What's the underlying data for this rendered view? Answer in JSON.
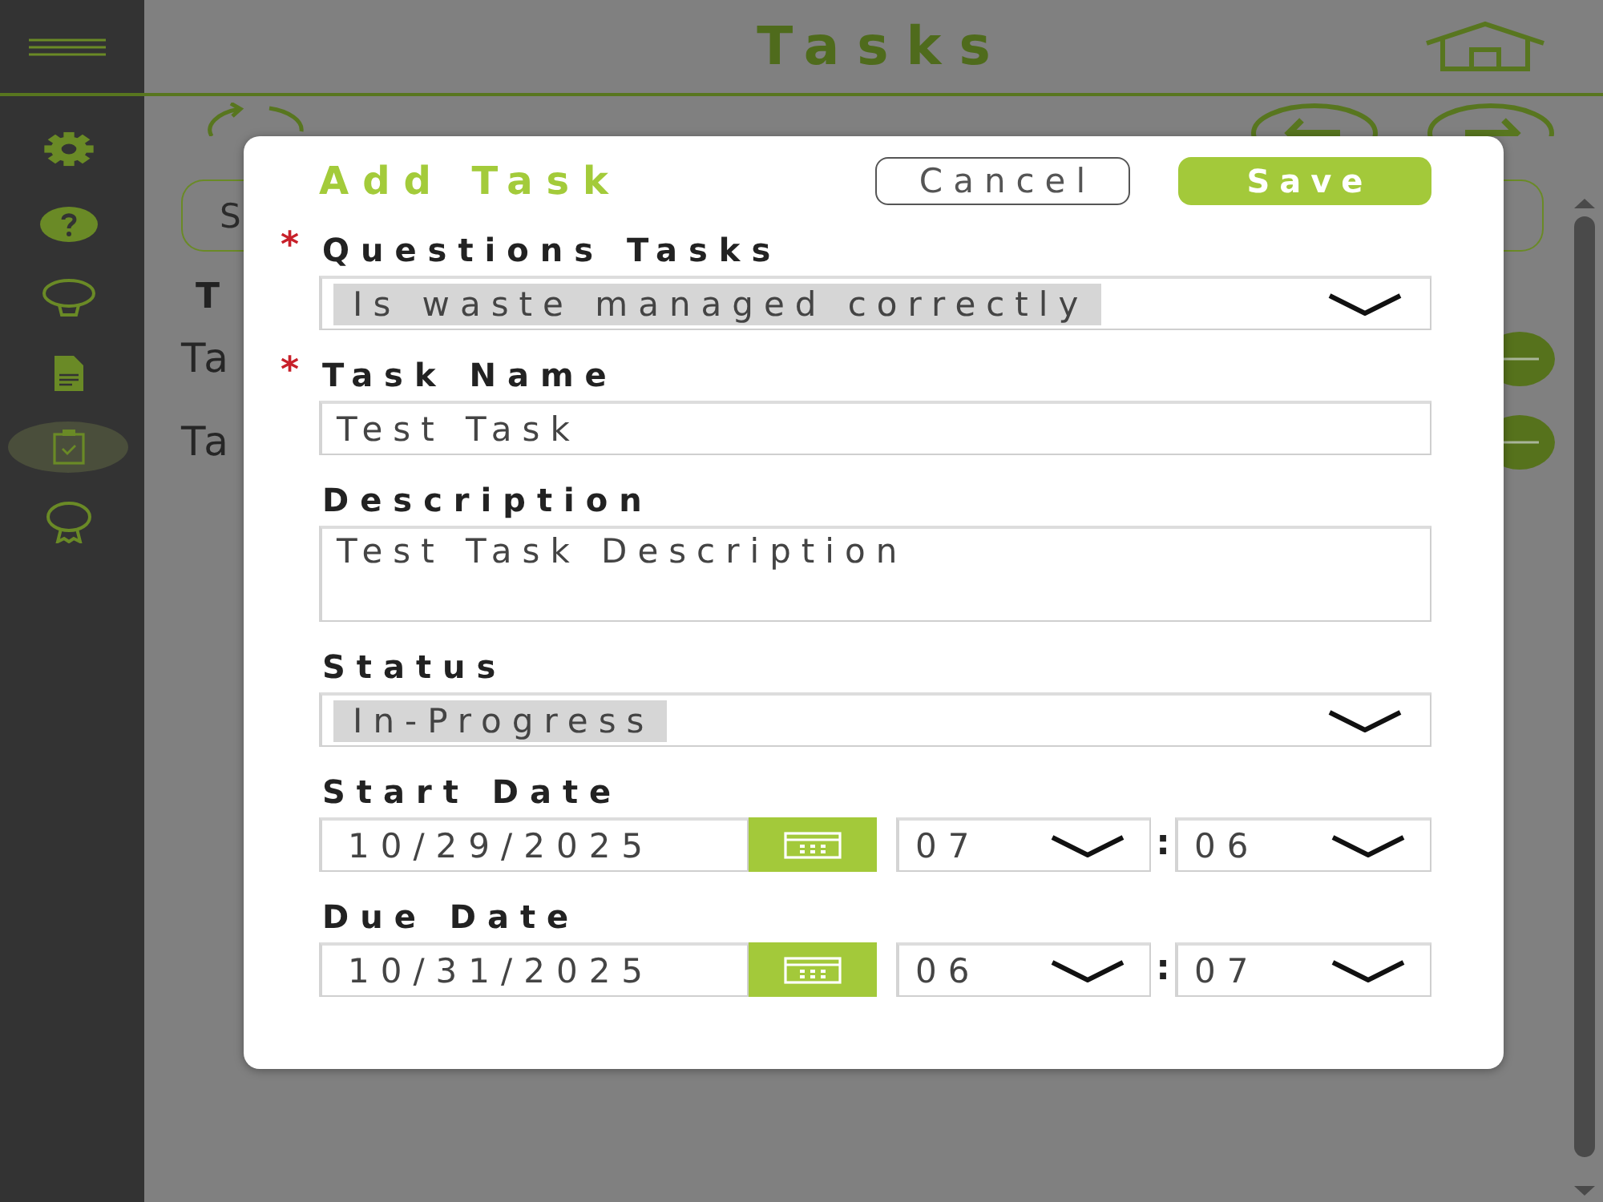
{
  "sidebar": {
    "items": [
      {
        "selected": false
      },
      {
        "selected": false
      },
      {
        "selected": false
      },
      {
        "selected": false
      },
      {
        "selected": true
      },
      {
        "selected": false
      }
    ]
  },
  "header": {
    "title": "Tasks"
  },
  "text_box": {
    "text": "S"
  },
  "list": {
    "heading": "T",
    "rows": [
      {
        "text": "Ta"
      },
      {
        "text": "Ta"
      }
    ]
  },
  "dialog": {
    "title": "Add Task",
    "buttons": [
      {
        "label": "Cancel",
        "kind": "secondary"
      },
      {
        "label": "Save",
        "kind": "primary"
      }
    ],
    "fields": [
      {
        "kind": "select",
        "required_mark": "*",
        "label": "Questions Tasks",
        "value": "Is waste managed correctly"
      },
      {
        "kind": "text",
        "required_mark": "*",
        "label": "Task Name",
        "value": "Test Task"
      },
      {
        "kind": "textarea",
        "label": "Description",
        "value": "Test Task Description"
      },
      {
        "kind": "select",
        "label": "Status",
        "value": "In-Progress"
      },
      {
        "kind": "datetime",
        "label": "Start Date",
        "date": "10/29/2025",
        "hour": "07",
        "separator": ":",
        "minute": "06"
      },
      {
        "kind": "datetime",
        "label": "Due Date",
        "date": "10/31/2025",
        "hour": "06",
        "separator": ":",
        "minute": "07"
      }
    ]
  }
}
